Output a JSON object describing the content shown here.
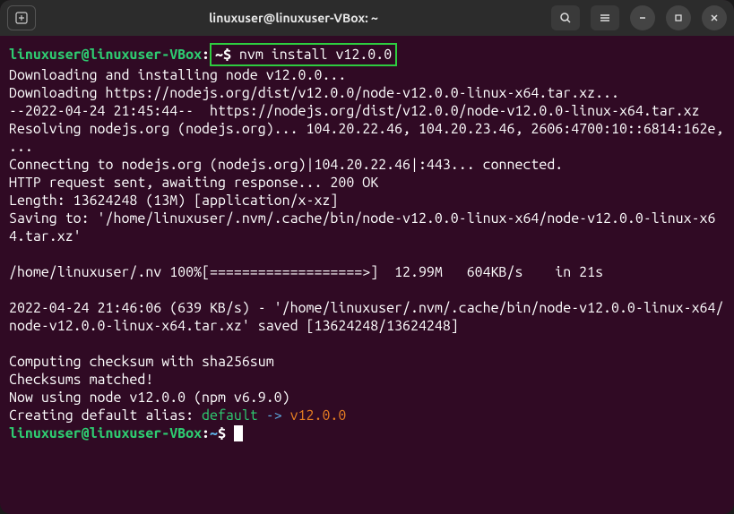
{
  "titlebar": {
    "title": "linuxuser@linuxuser-VBox: ~"
  },
  "prompt": {
    "user_host": "linuxuser@linuxuser-VBox",
    "colon": ":",
    "path": "~",
    "dollar": "$",
    "command": "nvm install v12.0.0"
  },
  "output": {
    "l1": "Downloading and installing node v12.0.0...",
    "l2": "Downloading https://nodejs.org/dist/v12.0.0/node-v12.0.0-linux-x64.tar.xz...",
    "l3": "--2022-04-24 21:45:44--  https://nodejs.org/dist/v12.0.0/node-v12.0.0-linux-x64.tar.xz",
    "l4": "Resolving nodejs.org (nodejs.org)... 104.20.22.46, 104.20.23.46, 2606:4700:10::6814:162e, ...",
    "l5": "Connecting to nodejs.org (nodejs.org)|104.20.22.46|:443... connected.",
    "l6": "HTTP request sent, awaiting response... 200 OK",
    "l7": "Length: 13624248 (13M) [application/x-xz]",
    "l8": "Saving to: '/home/linuxuser/.nvm/.cache/bin/node-v12.0.0-linux-x64/node-v12.0.0-linux-x64.tar.xz'",
    "l9": "",
    "l10": "/home/linuxuser/.nv 100%[===================>]  12.99M   604KB/s    in 21s",
    "l11": "",
    "l12": "2022-04-24 21:46:06 (639 KB/s) - '/home/linuxuser/.nvm/.cache/bin/node-v12.0.0-linux-x64/node-v12.0.0-linux-x64.tar.xz' saved [13624248/13624248]",
    "l13": "",
    "l14": "Computing checksum with sha256sum",
    "l15": "Checksums matched!",
    "l16": "Now using node v12.0.0 (npm v6.9.0)",
    "alias_prefix": "Creating default alias: ",
    "alias_default": "default",
    "alias_arrow": " -> ",
    "alias_version": "v12.0.0"
  }
}
